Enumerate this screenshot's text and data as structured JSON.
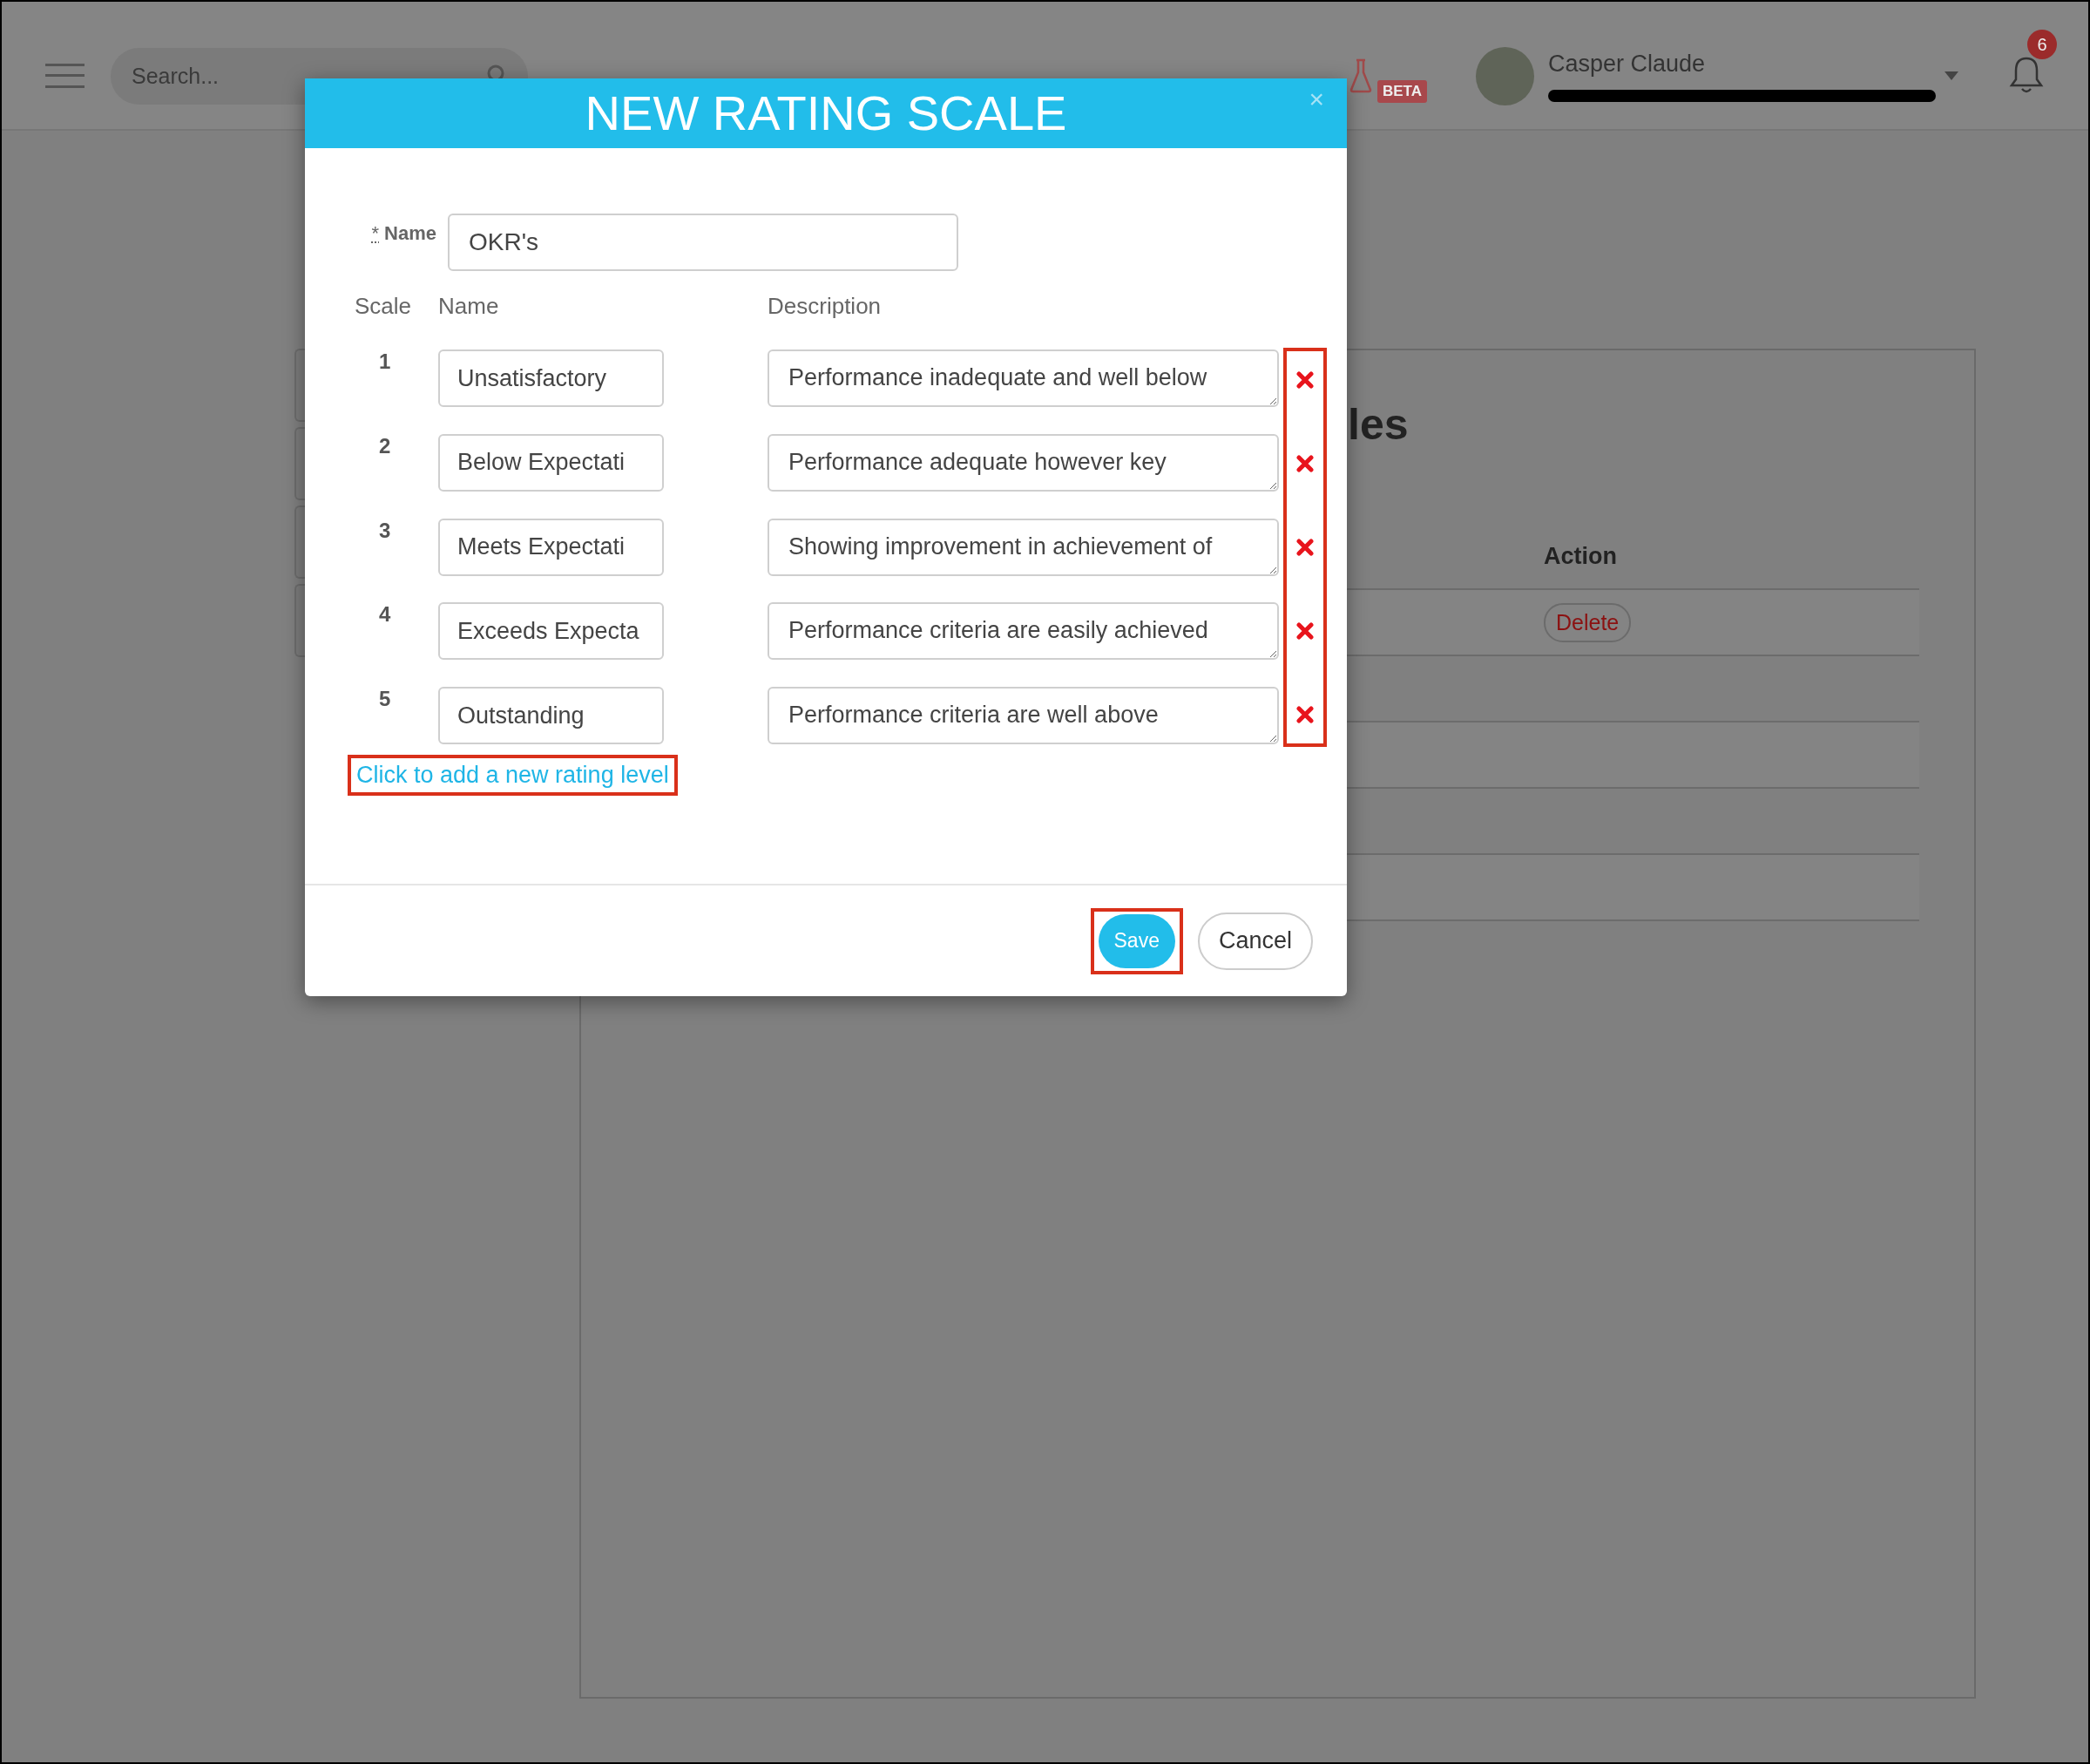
{
  "topbar": {
    "search": {
      "placeholder": "Search..."
    },
    "beta_badge": "BETA",
    "user": {
      "name": "Casper Claude"
    },
    "notifications": {
      "count": "6"
    }
  },
  "background_page": {
    "title_fragment": "les",
    "table": {
      "columns": [
        "Action"
      ],
      "rows": [
        {
          "action": "Delete"
        }
      ]
    }
  },
  "dialog": {
    "title": "NEW RATING SCALE",
    "close": "×",
    "name_field": {
      "required_mark": "*",
      "label": "Name",
      "value": "OKR's"
    },
    "columns": [
      "Scale",
      "Name",
      "Description"
    ],
    "levels": [
      {
        "scale": "1",
        "name": "Unsatisfactory",
        "description": "Performance inadequate and well below"
      },
      {
        "scale": "2",
        "name": "Below Expectati",
        "description": "Performance adequate however key"
      },
      {
        "scale": "3",
        "name": "Meets Expectati",
        "description": "Showing improvement in achievement of"
      },
      {
        "scale": "4",
        "name": "Exceeds Expecta",
        "description": "Performance criteria are easily achieved"
      },
      {
        "scale": "5",
        "name": "Outstanding",
        "description": "Performance criteria are well above"
      }
    ],
    "delete_column_highlighted": true,
    "add_level_link": {
      "label": "Click to add a new rating level",
      "highlighted": true
    },
    "buttons": [
      {
        "label": "Save",
        "kind": "primary",
        "highlighted": true
      },
      {
        "label": "Cancel",
        "kind": "secondary",
        "highlighted": false
      }
    ]
  }
}
